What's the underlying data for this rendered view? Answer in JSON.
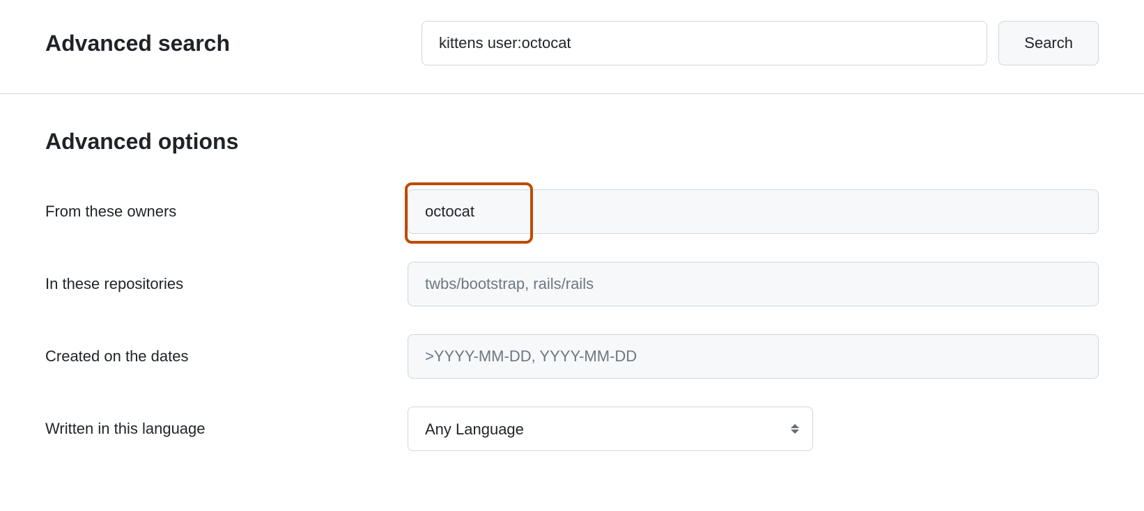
{
  "header": {
    "title": "Advanced search",
    "search_value": "kittens user:octocat",
    "search_button_label": "Search"
  },
  "options": {
    "section_title": "Advanced options",
    "owners": {
      "label": "From these owners",
      "value": "octocat",
      "highlighted": true
    },
    "repositories": {
      "label": "In these repositories",
      "value": "",
      "placeholder": "twbs/bootstrap, rails/rails"
    },
    "created": {
      "label": "Created on the dates",
      "value": "",
      "placeholder": ">YYYY-MM-DD, YYYY-MM-DD"
    },
    "language": {
      "label": "Written in this language",
      "selected": "Any Language"
    }
  }
}
